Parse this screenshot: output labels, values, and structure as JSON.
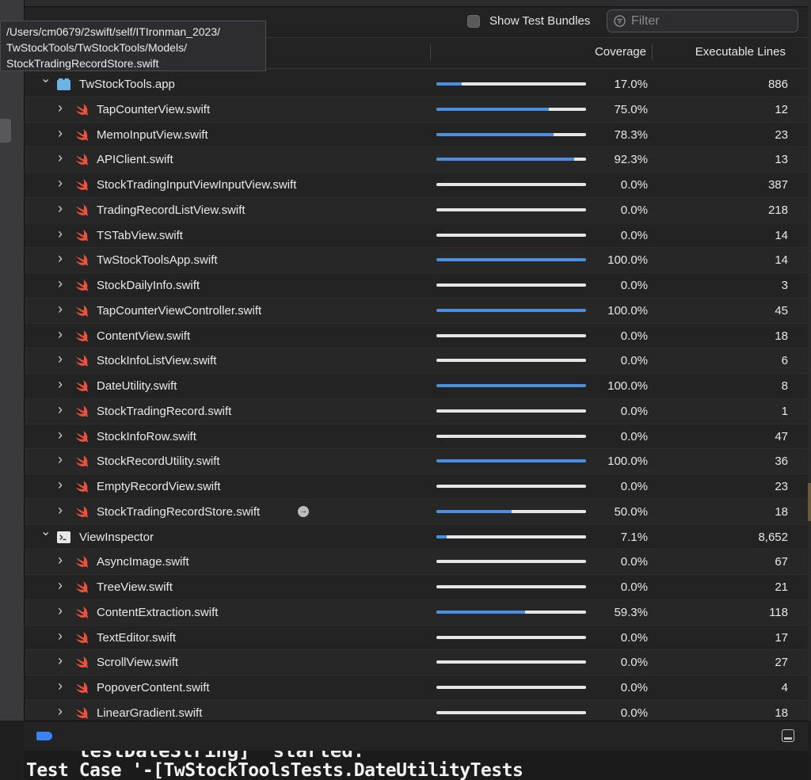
{
  "tooltip": {
    "line1": "/Users/cm0679/2swift/self/ITIronman_2023/",
    "line2": "TwStockTools/TwStockTools/Models/",
    "line3": "StockTradingRecordStore.swift"
  },
  "toolbar": {
    "show_test_bundles_label": "Show Test Bundles",
    "show_test_bundles_checked": false,
    "filter_placeholder": "Filter"
  },
  "columns": {
    "coverage": "Coverage",
    "executable_lines": "Executable Lines"
  },
  "colors": {
    "coverage_fill": "#4a90e2",
    "coverage_track": "#e6e6e6",
    "swift_orange": "#f05138",
    "target_blue": "#6cb4e4"
  },
  "rows": [
    {
      "kind": "target",
      "icon": "app-icon",
      "name": "TwStockTools.app",
      "coverage": 17.0,
      "pct": "17.0%",
      "lines": "886"
    },
    {
      "kind": "file",
      "icon": "swift-icon",
      "name": "TapCounterView.swift",
      "coverage": 75.0,
      "pct": "75.0%",
      "lines": "12"
    },
    {
      "kind": "file",
      "icon": "swift-icon",
      "name": "MemoInputView.swift",
      "coverage": 78.3,
      "pct": "78.3%",
      "lines": "23"
    },
    {
      "kind": "file",
      "icon": "swift-icon",
      "name": "APIClient.swift",
      "coverage": 92.3,
      "pct": "92.3%",
      "lines": "13"
    },
    {
      "kind": "file",
      "icon": "swift-icon",
      "name": "StockTradingInputViewInputView.swift",
      "coverage": 0.0,
      "pct": "0.0%",
      "lines": "387"
    },
    {
      "kind": "file",
      "icon": "swift-icon",
      "name": "TradingRecordListView.swift",
      "coverage": 0.0,
      "pct": "0.0%",
      "lines": "218"
    },
    {
      "kind": "file",
      "icon": "swift-icon",
      "name": "TSTabView.swift",
      "coverage": 0.0,
      "pct": "0.0%",
      "lines": "14"
    },
    {
      "kind": "file",
      "icon": "swift-icon",
      "name": "TwStockToolsApp.swift",
      "coverage": 100.0,
      "pct": "100.0%",
      "lines": "14"
    },
    {
      "kind": "file",
      "icon": "swift-icon",
      "name": "StockDailyInfo.swift",
      "coverage": 0.0,
      "pct": "0.0%",
      "lines": "3"
    },
    {
      "kind": "file",
      "icon": "swift-icon",
      "name": "TapCounterViewController.swift",
      "coverage": 100.0,
      "pct": "100.0%",
      "lines": "45"
    },
    {
      "kind": "file",
      "icon": "swift-icon",
      "name": "ContentView.swift",
      "coverage": 0.0,
      "pct": "0.0%",
      "lines": "18"
    },
    {
      "kind": "file",
      "icon": "swift-icon",
      "name": "StockInfoListView.swift",
      "coverage": 0.0,
      "pct": "0.0%",
      "lines": "6"
    },
    {
      "kind": "file",
      "icon": "swift-icon",
      "name": "DateUtility.swift",
      "coverage": 100.0,
      "pct": "100.0%",
      "lines": "8"
    },
    {
      "kind": "file",
      "icon": "swift-icon",
      "name": "StockTradingRecord.swift",
      "coverage": 0.0,
      "pct": "0.0%",
      "lines": "1"
    },
    {
      "kind": "file",
      "icon": "swift-icon",
      "name": "StockInfoRow.swift",
      "coverage": 0.0,
      "pct": "0.0%",
      "lines": "47"
    },
    {
      "kind": "file",
      "icon": "swift-icon",
      "name": "StockRecordUtility.swift",
      "coverage": 100.0,
      "pct": "100.0%",
      "lines": "36"
    },
    {
      "kind": "file",
      "icon": "swift-icon",
      "name": "EmptyRecordView.swift",
      "coverage": 0.0,
      "pct": "0.0%",
      "lines": "23"
    },
    {
      "kind": "file",
      "icon": "swift-icon",
      "name": "StockTradingRecordStore.swift",
      "coverage": 50.0,
      "pct": "50.0%",
      "lines": "18",
      "goto": true
    },
    {
      "kind": "target",
      "icon": "terminal-icon",
      "name": "ViewInspector",
      "coverage": 7.1,
      "pct": "7.1%",
      "lines": "8,652"
    },
    {
      "kind": "file",
      "icon": "swift-icon",
      "name": "AsyncImage.swift",
      "coverage": 0.0,
      "pct": "0.0%",
      "lines": "67"
    },
    {
      "kind": "file",
      "icon": "swift-icon",
      "name": "TreeView.swift",
      "coverage": 0.0,
      "pct": "0.0%",
      "lines": "21"
    },
    {
      "kind": "file",
      "icon": "swift-icon",
      "name": "ContentExtraction.swift",
      "coverage": 59.3,
      "pct": "59.3%",
      "lines": "118"
    },
    {
      "kind": "file",
      "icon": "swift-icon",
      "name": "TextEditor.swift",
      "coverage": 0.0,
      "pct": "0.0%",
      "lines": "17"
    },
    {
      "kind": "file",
      "icon": "swift-icon",
      "name": "ScrollView.swift",
      "coverage": 0.0,
      "pct": "0.0%",
      "lines": "27"
    },
    {
      "kind": "file",
      "icon": "swift-icon",
      "name": "PopoverContent.swift",
      "coverage": 0.0,
      "pct": "0.0%",
      "lines": "4"
    },
    {
      "kind": "file",
      "icon": "swift-icon",
      "name": "LinearGradient.swift",
      "coverage": 0.0,
      "pct": "0.0%",
      "lines": "18"
    }
  ],
  "console": {
    "cut_line": "testDateString]' started.",
    "line": "Test Case '-[TwStockToolsTests.DateUtilityTests"
  }
}
